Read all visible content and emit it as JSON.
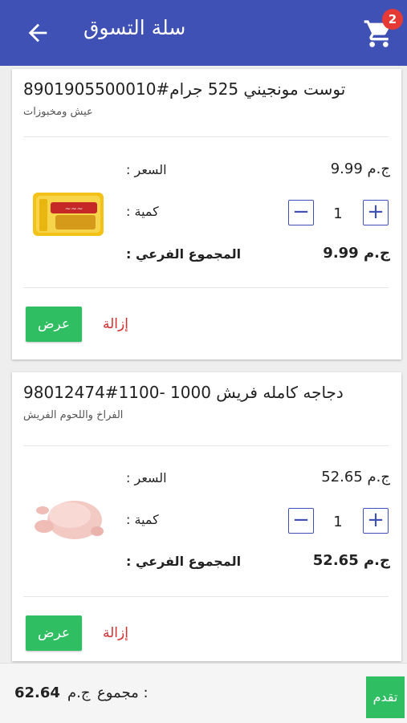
{
  "appbar": {
    "title": "سلة التسوق",
    "cart_count": "2"
  },
  "items": [
    {
      "name": "توست مونجيني 525 جرام#8901905500010",
      "category": "عيش ومخبوزات",
      "price_label": ": السعر",
      "price_value": "ج.م 9.99",
      "qty_label": ": كمية",
      "qty_value": "1",
      "subtotal_label": ": المجموع الفرعي",
      "subtotal_value": "ج.م 9.99",
      "view_label": "عرض",
      "remove_label": "إزالة"
    },
    {
      "name": "دجاجه كامله فريش 1000 -1100#98012474",
      "category": "الفراخ واللحوم الفريش",
      "price_label": ": السعر",
      "price_value": "ج.م 52.65",
      "qty_label": ": كمية",
      "qty_value": "1",
      "subtotal_label": ": المجموع الفرعي",
      "subtotal_value": "ج.م 52.65",
      "view_label": "عرض",
      "remove_label": "إزالة"
    }
  ],
  "footer": {
    "total_label": "مجموع :",
    "currency": "ج.م",
    "total_value": "62.64",
    "proceed_label": "تقدم"
  },
  "colors": {
    "primary": "#3f51b5",
    "accent_green": "#2fbf62",
    "remove_red": "#d32f2f",
    "badge_red": "#e53935"
  }
}
